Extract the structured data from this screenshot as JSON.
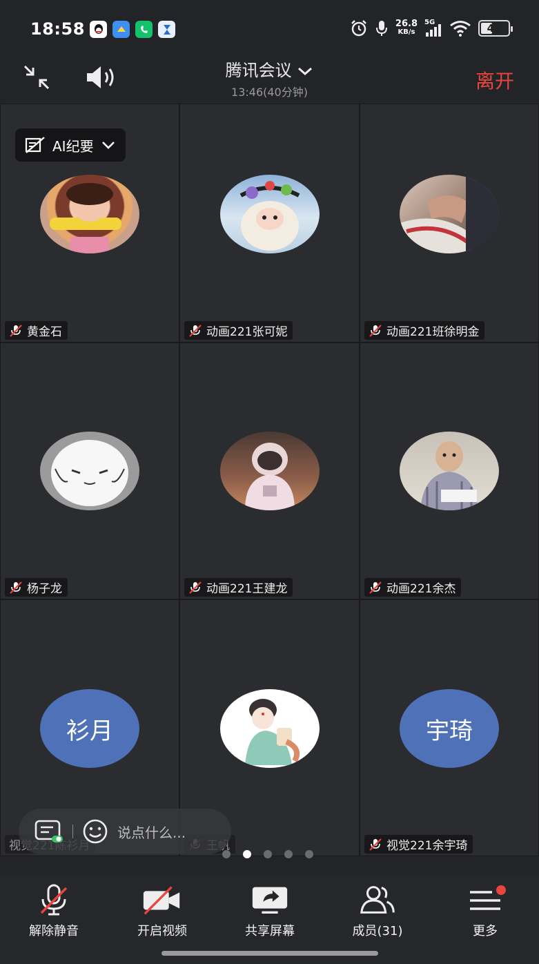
{
  "status_bar": {
    "time": "18:58",
    "net_speed_value": "26.8",
    "net_speed_unit": "KB/s",
    "network": "5G",
    "battery": "41",
    "battery_level_percent": 41,
    "app_icons": [
      "qq-icon",
      "cloud-app-icon",
      "phone-app-icon",
      "hourglass-app-icon"
    ]
  },
  "header": {
    "title": "腾讯会议",
    "subtitle": "13:46(40分钟)",
    "leave_label": "离开"
  },
  "ai_summary": {
    "label": "AI纪要"
  },
  "participants": [
    {
      "name": "黄金石",
      "avatar": "photo-girl-corn"
    },
    {
      "name": "动画221张可妮",
      "avatar": "photo-plush-toy"
    },
    {
      "name": "动画221班徐明金",
      "avatar": "photo-hand-shoe"
    },
    {
      "name": "杨子龙",
      "avatar": "photo-cartoon-bun"
    },
    {
      "name": "动画221王建龙",
      "avatar": "photo-astronaut"
    },
    {
      "name": "动画221余杰",
      "avatar": "photo-man-chair"
    },
    {
      "name": "视觉221陈衫月",
      "avatar_text": "衫月"
    },
    {
      "name": "王帆",
      "avatar": "photo-cartoon-girl"
    },
    {
      "name": "视觉221余宇琦",
      "avatar_text": "宇琦"
    }
  ],
  "chat": {
    "placeholder": "说点什么..."
  },
  "pagination": {
    "count": 5,
    "active": 2
  },
  "toolbar": {
    "unmute": "解除静音",
    "video": "开启视频",
    "share": "共享屏幕",
    "members": "成员(31)",
    "more": "更多"
  },
  "colors": {
    "background": "#232427",
    "tile": "#2b2c30",
    "leave": "#e8453c",
    "avatar_text_bg": "#4e71b8"
  }
}
